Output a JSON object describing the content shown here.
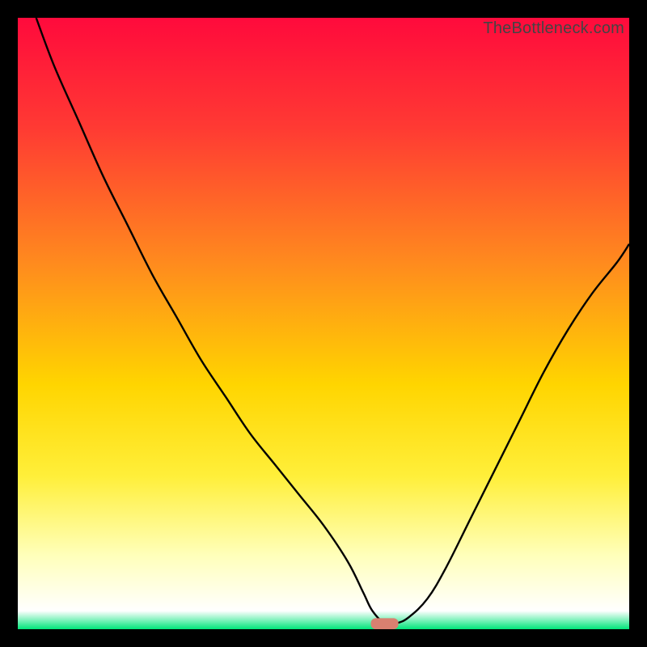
{
  "watermark": "TheBottleneck.com",
  "chart_data": {
    "type": "line",
    "title": "",
    "xlabel": "",
    "ylabel": "",
    "xlim": [
      0,
      100
    ],
    "ylim": [
      0,
      100
    ],
    "grid": false,
    "legend": false,
    "gradient_stops": [
      {
        "offset": 0,
        "color": "#ff0a3c"
      },
      {
        "offset": 0.18,
        "color": "#ff3a33"
      },
      {
        "offset": 0.4,
        "color": "#ff8a1e"
      },
      {
        "offset": 0.6,
        "color": "#ffd500"
      },
      {
        "offset": 0.75,
        "color": "#ffef3a"
      },
      {
        "offset": 0.88,
        "color": "#ffffbb"
      },
      {
        "offset": 0.97,
        "color": "#ffffff"
      },
      {
        "offset": 1.0,
        "color": "#00e57a"
      }
    ],
    "series": [
      {
        "name": "bottleneck-curve",
        "color": "#000000",
        "x": [
          3,
          6,
          10,
          14,
          18,
          22,
          26,
          30,
          34,
          38,
          42,
          46,
          50,
          54,
          56.5,
          58,
          60,
          62,
          64,
          67,
          70,
          74,
          78,
          82,
          86,
          90,
          94,
          98,
          100
        ],
        "y": [
          100,
          92,
          83,
          74,
          66,
          58,
          51,
          44,
          38,
          32,
          27,
          22,
          17,
          11,
          6,
          3,
          1,
          1,
          2,
          5,
          10,
          18,
          26,
          34,
          42,
          49,
          55,
          60,
          63
        ]
      }
    ],
    "marker": {
      "name": "optimal-marker",
      "color": "#d98070",
      "x": 60,
      "y": 0,
      "width": 4.5,
      "height": 1.8
    }
  }
}
